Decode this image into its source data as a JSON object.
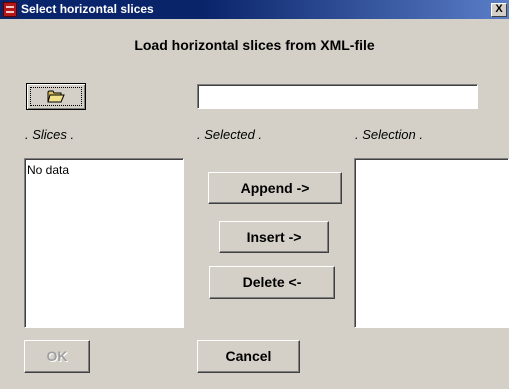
{
  "window": {
    "title": "Select horizontal slices",
    "close_label": "X"
  },
  "heading": "Load horizontal slices from XML-file",
  "file": {
    "path_value": ""
  },
  "columns": {
    "slices_label": ".   Slices   .",
    "selected_label": ". Selected .",
    "selection_label": ".   Selection  ."
  },
  "slices_list": {
    "items": [
      "No data"
    ]
  },
  "selection_list": {
    "items": []
  },
  "buttons": {
    "append": "Append  ->",
    "insert": "Insert ->",
    "delete": "Delete  <-",
    "ok": "OK",
    "cancel": "Cancel"
  },
  "icons": {
    "open_folder": "open-folder-icon",
    "app": "app-icon",
    "close": "close-icon"
  }
}
